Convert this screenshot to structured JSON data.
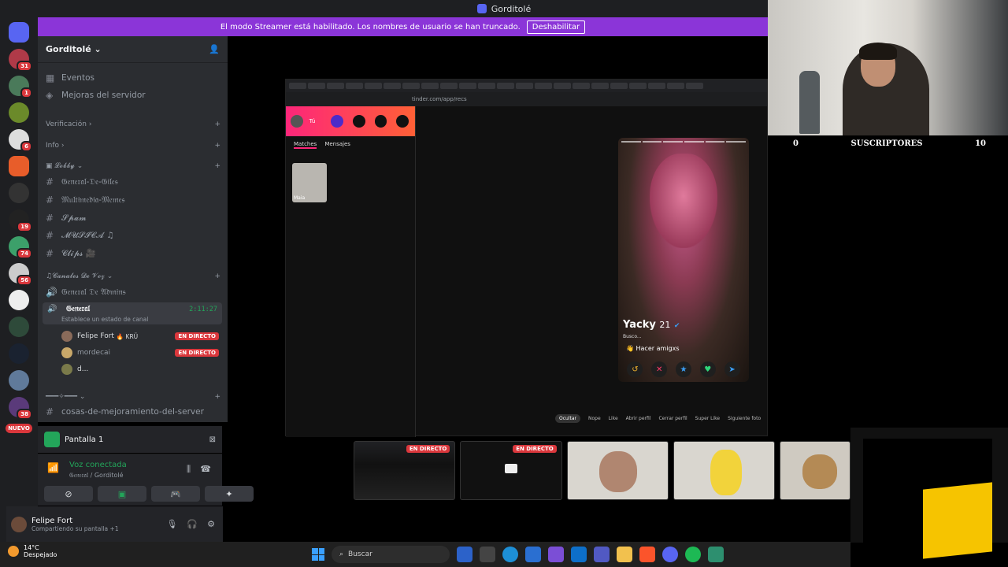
{
  "window": {
    "title": "Gorditolé"
  },
  "banner": {
    "text": "El modo Streamer está habilitado. Los nombres de usuario se han truncado.",
    "button": "Deshabilitar"
  },
  "rail": {
    "badges": [
      "31",
      "1",
      "6",
      "19",
      "74",
      "56",
      "38"
    ],
    "nuevo": "NUEVO"
  },
  "server": {
    "name": "Gorditolé"
  },
  "sidebar": {
    "top_items": [
      {
        "label": "Eventos",
        "icon": "calendar-icon"
      },
      {
        "label": "Mejoras del servidor",
        "icon": "boost-icon"
      }
    ],
    "categories": {
      "verificacion": "Verificación",
      "info": "Info",
      "lobby": "𝓛𝓸𝓫𝓫𝔂",
      "voz": "♫𝓒𝓪𝓷𝓪𝓵𝓮𝓼 𝓓𝓮 𝓥𝓸𝔃",
      "separator": "━━━✧━━━"
    },
    "text_channels": [
      "𝔊𝔢𝔫𝔢𝔯𝔞𝔩-𝔇𝔢-𝔊𝔦𝔩𝔢𝔰",
      "𝔐𝔲𝔩𝔱𝔦𝔪𝔢𝔡𝔦𝔞-𝔐𝔢𝔪𝔢𝔰",
      "𝓢𝓹𝓪𝓶",
      "𝓜𝓤𝓢𝓘𝓒𝓐 ♫",
      "𝓒𝓵𝓲𝓹𝓼 🎥"
    ],
    "voice_admin": "𝔊𝔢𝔫𝔢𝔯𝔞𝔩 𝔇𝔢 𝔄𝔡𝔪𝔦𝔫𝔰",
    "voice_general": {
      "name": "𝔊𝔢𝔫𝔢𝔯𝔞𝔩",
      "status": "Establece un estado de canal",
      "time": "2:11:27"
    },
    "members": [
      {
        "name": "Felipe Fort",
        "tag": "🔥 KRÜ",
        "live": "EN DIRECTO"
      },
      {
        "name": "mordecai",
        "tag": "",
        "live": "EN DIRECTO"
      },
      {
        "name": "d...",
        "tag": "",
        "live": ""
      }
    ],
    "last_channel": "cosas-de-mejoramiento-del-server"
  },
  "screen_panel": {
    "label": "Pantalla 1"
  },
  "voice_panel": {
    "status": "Voz conectada",
    "sub": "𝔊𝔢𝔫𝔢𝔯𝔞𝔩 / Gorditolé"
  },
  "user_panel": {
    "name": "Felipe Fort",
    "status": "Compartiendo su pantalla +1"
  },
  "stream": {
    "url": "tinder.com/app/recs",
    "tinder_me": "Tú",
    "tabs": [
      "Matches",
      "Mensajes"
    ],
    "match_name": "Maia",
    "card": {
      "name": "Yacky",
      "age": "21",
      "busco": "Busco...",
      "intent": "Hacer amigxs"
    },
    "keybar": [
      "Ocultar",
      "Nope",
      "Like",
      "Abrir perfil",
      "Cerrar perfil",
      "Super Like",
      "Siguiente foto"
    ]
  },
  "webcam": {
    "left": "0",
    "label": "SUSCRIPTORES",
    "right": "10"
  },
  "thumbs": {
    "live_label": "EN DIRECTO"
  },
  "taskbar": {
    "temp": "14°C",
    "weather": "Despejado",
    "search": "Buscar"
  }
}
